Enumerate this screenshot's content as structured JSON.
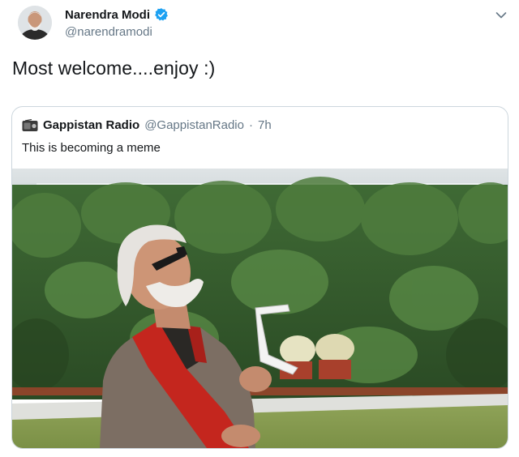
{
  "tweet": {
    "author": {
      "name": "Narendra Modi",
      "handle": "@narendramodi",
      "verified": true,
      "avatar_icon": "profile-photo"
    },
    "text": "Most welcome....enjoy :)",
    "menu_icon": "chevron-down-icon"
  },
  "quoted_tweet": {
    "author": {
      "name": "Gappistan Radio",
      "handle": "@GappistanRadio",
      "avatar_icon": "radio-icon"
    },
    "separator": "·",
    "time": "7h",
    "text": "This is becoming a meme",
    "media": {
      "type": "photo",
      "subject": "man holding eclipse glasses looking at the sky"
    }
  },
  "colors": {
    "text_primary": "#14171a",
    "text_secondary": "#657786",
    "verified_blue": "#1da1f2",
    "card_border": "#ccd6dd"
  }
}
